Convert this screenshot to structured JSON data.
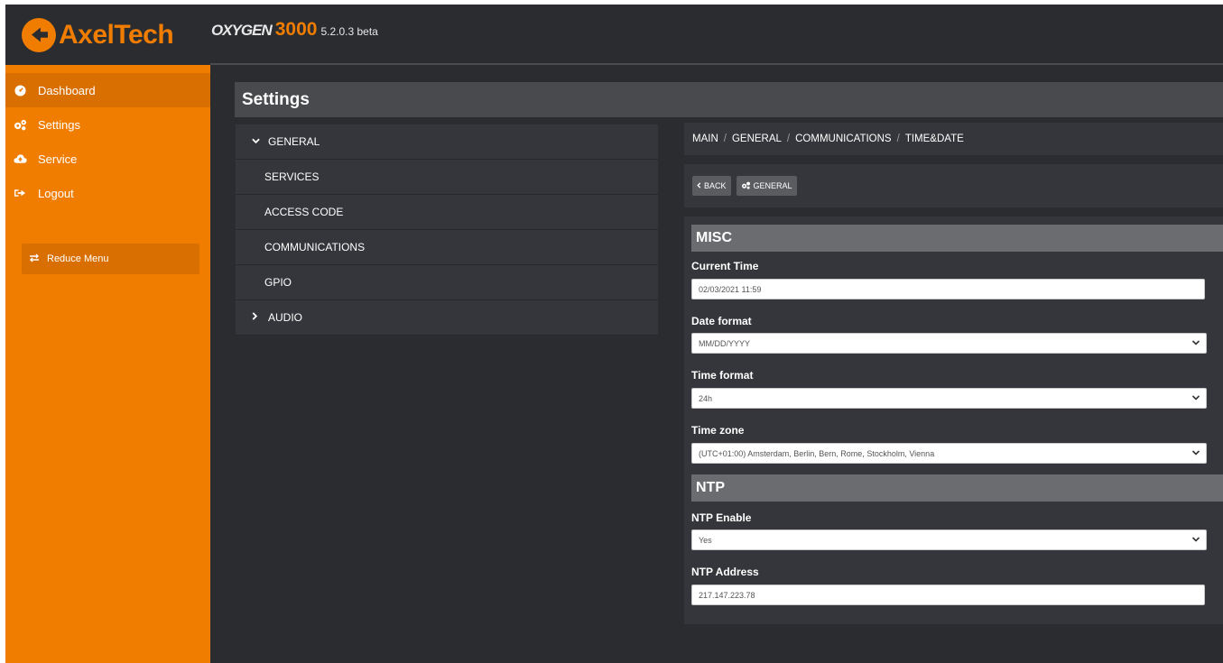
{
  "header": {
    "logo_text": "AxelTech",
    "product_name": "OXYGEN",
    "product_number": "3000",
    "product_version": "5.2.0.3 beta"
  },
  "sidebar": {
    "items": [
      {
        "label": "Dashboard",
        "icon": "dashboard-icon"
      },
      {
        "label": "Settings",
        "icon": "gears-icon"
      },
      {
        "label": "Service",
        "icon": "cloud-icon"
      },
      {
        "label": "Logout",
        "icon": "logout-icon"
      }
    ],
    "reduce_label": "Reduce Menu"
  },
  "page": {
    "title": "Settings"
  },
  "tree": {
    "items": [
      {
        "label": "GENERAL"
      },
      {
        "label": "SERVICES"
      },
      {
        "label": "ACCESS CODE"
      },
      {
        "label": "COMMUNICATIONS"
      },
      {
        "label": "GPIO"
      },
      {
        "label": "AUDIO"
      }
    ]
  },
  "breadcrumb": [
    "MAIN",
    "GENERAL",
    "COMMUNICATIONS",
    "TIME&DATE"
  ],
  "toolbar": {
    "back_label": "BACK",
    "general_label": "GENERAL"
  },
  "form": {
    "misc_title": "MISC",
    "current_time_label": "Current Time",
    "current_time_value": "02/03/2021 11:59",
    "date_format_label": "Date format",
    "date_format_value": "MM/DD/YYYY",
    "time_format_label": "Time format",
    "time_format_value": "24h",
    "time_zone_label": "Time zone",
    "time_zone_value": "(UTC+01:00) Amsterdam, Berlin, Bern, Rome, Stockholm, Vienna",
    "ntp_title": "NTP",
    "ntp_enable_label": "NTP Enable",
    "ntp_enable_value": "Yes",
    "ntp_address_label": "NTP Address",
    "ntp_address_value": "217.147.223.78"
  },
  "colors": {
    "accent": "#f07d00",
    "background": "#2a2c30",
    "panel": "#34363b"
  }
}
